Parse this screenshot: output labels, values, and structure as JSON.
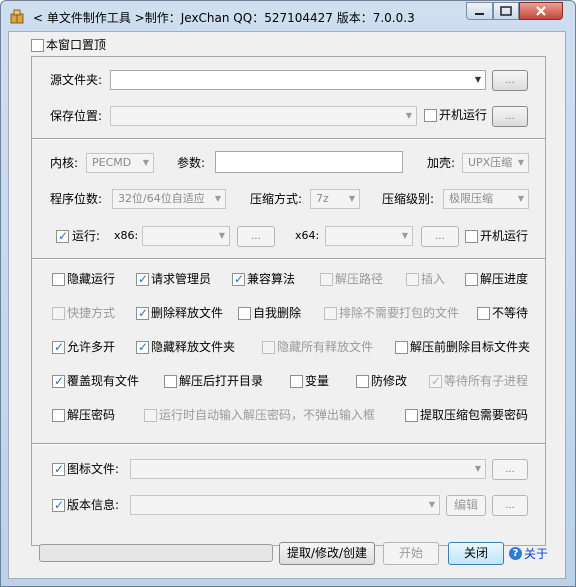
{
  "window": {
    "title": "< 单文件制作工具 >制作：JexChan  QQ：527104427  版本：7.0.0.3"
  },
  "always_on_top": {
    "label": "本窗口置顶",
    "checked": false
  },
  "files": {
    "source_label": "源文件夹:",
    "source_value": "",
    "save_label": "保存位置:",
    "save_value": "",
    "startup_label": "开机运行",
    "startup_checked": false,
    "browse_label": "..."
  },
  "settings": {
    "kernel_label": "内核:",
    "kernel_value": "PECMD",
    "params_label": "参数:",
    "params_value": "",
    "shell_label": "加壳:",
    "shell_value": "UPX压缩",
    "bits_label": "程序位数:",
    "bits_value": "32位/64位自适应",
    "compress_label": "压缩方式:",
    "compress_value": "7z",
    "level_label": "压缩级别:",
    "level_value": "极限压缩",
    "run_label": "运行:",
    "run_checked": true,
    "x86_label": "x86:",
    "x64_label": "x64:",
    "startup2_label": "开机运行",
    "startup2_checked": false,
    "browse_label": "..."
  },
  "options": [
    {
      "label": "隐藏运行",
      "checked": false,
      "enabled": true
    },
    {
      "label": "请求管理员",
      "checked": true,
      "enabled": true
    },
    {
      "label": "兼容算法",
      "checked": true,
      "enabled": true
    },
    {
      "label": "解压路径",
      "checked": false,
      "enabled": false
    },
    {
      "label": "插入",
      "checked": false,
      "enabled": false
    },
    {
      "label": "解压进度",
      "checked": false,
      "enabled": true
    },
    {
      "label": "快捷方式",
      "checked": false,
      "enabled": false
    },
    {
      "label": "删除释放文件",
      "checked": true,
      "enabled": true
    },
    {
      "label": "自我删除",
      "checked": false,
      "enabled": true
    },
    {
      "label": "排除不需要打包的文件",
      "checked": false,
      "enabled": false
    },
    {
      "label": "不等待",
      "checked": false,
      "enabled": true
    },
    {
      "label": "允许多开",
      "checked": true,
      "enabled": true
    },
    {
      "label": "隐藏释放文件夹",
      "checked": true,
      "enabled": true
    },
    {
      "label": "隐藏所有释放文件",
      "checked": false,
      "enabled": false
    },
    {
      "label": "解压前删除目标文件夹",
      "checked": false,
      "enabled": true
    },
    {
      "label": "覆盖现有文件",
      "checked": true,
      "enabled": true
    },
    {
      "label": "解压后打开目录",
      "checked": false,
      "enabled": true
    },
    {
      "label": "变量",
      "checked": false,
      "enabled": true
    },
    {
      "label": "防修改",
      "checked": false,
      "enabled": true
    },
    {
      "label": "等待所有子进程",
      "checked": true,
      "enabled": false
    },
    {
      "label": "解压密码",
      "checked": false,
      "enabled": true
    },
    {
      "label": "运行时自动输入解压密码，不弹出输入框",
      "checked": false,
      "enabled": false
    },
    {
      "label": "提取压缩包需要密码",
      "checked": false,
      "enabled": true
    }
  ],
  "resources": {
    "icon_label": "图标文件:",
    "icon_checked": true,
    "version_label": "版本信息:",
    "version_checked": true,
    "edit_label": "编辑",
    "browse_label": "..."
  },
  "bottom": {
    "progress_value": 0,
    "extract_label": "提取/修改/创建",
    "start_label": "开始",
    "close_label": "关闭",
    "about_label": "关于",
    "about_icon_glyph": "?"
  }
}
